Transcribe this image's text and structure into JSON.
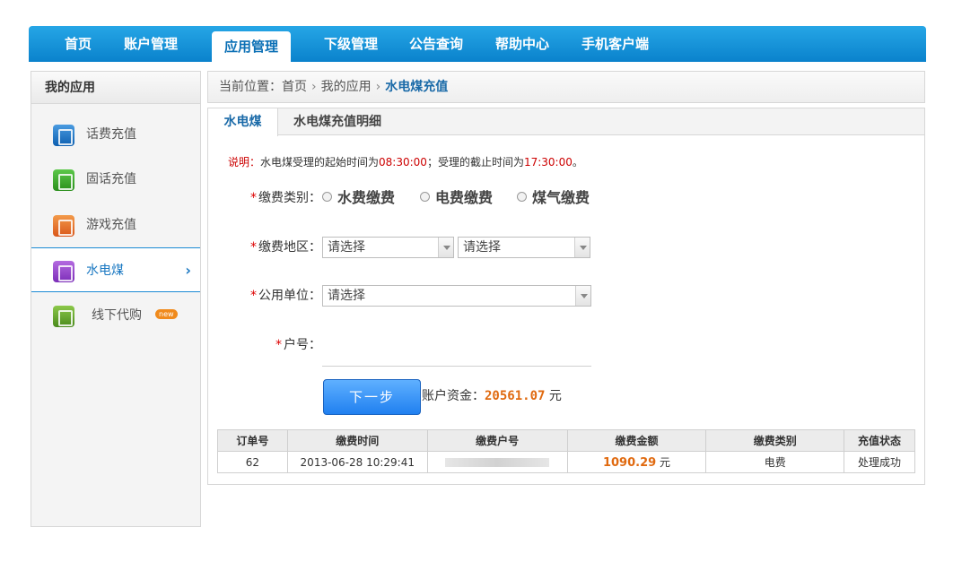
{
  "nav": {
    "items": [
      "首页",
      "账户管理",
      "应用管理",
      "下级管理",
      "公告查询",
      "帮助中心",
      "手机客户端"
    ],
    "active_index": 2
  },
  "sidebar": {
    "title": "我的应用",
    "items": [
      {
        "label": "话费充值",
        "icon": "phone-icon"
      },
      {
        "label": "固话充值",
        "icon": "telephone-icon"
      },
      {
        "label": "游戏充值",
        "icon": "gamepad-icon"
      },
      {
        "label": "水电煤",
        "icon": "utility-icon",
        "active": true,
        "chevron": "›"
      },
      {
        "label": "线下代购",
        "icon": "cart-icon",
        "badge": "new"
      }
    ]
  },
  "breadcrumb": {
    "prefix": "当前位置：",
    "items": [
      "首页",
      "我的应用",
      "水电煤充值"
    ],
    "separator": "›"
  },
  "tabs": [
    "水电煤",
    "水电煤充值明细"
  ],
  "notice": {
    "label": "说明：",
    "text1": "水电煤受理的起始时间为",
    "start": "08:30:00",
    "text2": "；受理的截止时间为",
    "end": "17:30:00",
    "text3": "。"
  },
  "form": {
    "type_label": "缴费类别：",
    "type_options": [
      "水费缴费",
      "电费缴费",
      "煤气缴费"
    ],
    "region_label": "缴费地区：",
    "region_selects": [
      "请选择",
      "请选择"
    ],
    "unit_label": "公用单位：",
    "unit_select": "请选择",
    "account_label": "户号：",
    "required_mark": "*",
    "next_button": "下一步",
    "funds_label": "账户资金：",
    "funds_amount": "20561.07",
    "funds_unit": "元"
  },
  "orders": {
    "headers": [
      "订单号",
      "缴费时间",
      "缴费户号",
      "缴费金额",
      "缴费类别",
      "充值状态"
    ],
    "rows": [
      {
        "id": "62",
        "time": "2013-06-28 10:29:41",
        "account": "",
        "amount": "1090.29",
        "amount_unit": "元",
        "type": "电费",
        "status": "处理成功"
      }
    ]
  },
  "colors": {
    "nav": "#0a82cc",
    "accent": "#1a6aa8",
    "money": "#e06a10",
    "required": "#dd0000"
  }
}
